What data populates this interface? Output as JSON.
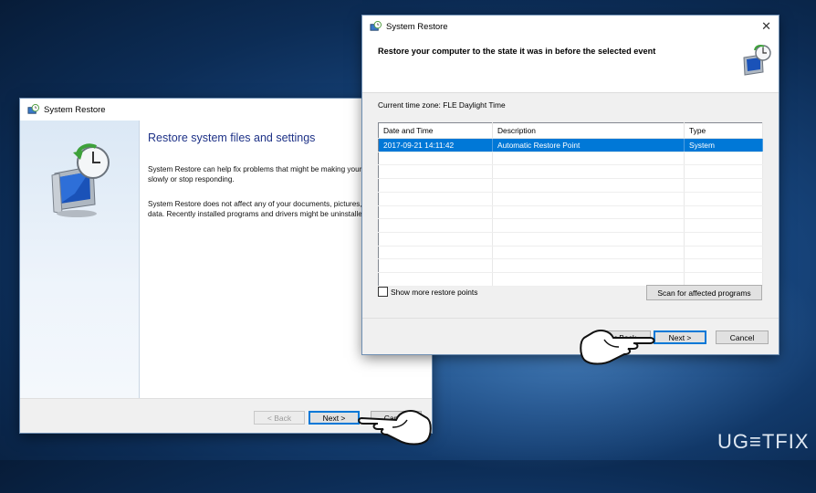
{
  "restore_wizard": {
    "title": "System Restore",
    "heading": "Restore system files and settings",
    "para1": "System Restore can help fix problems that might be making your computer run slowly or stop responding.",
    "para2": "System Restore does not affect any of your documents, pictures, or other personal data. Recently installed programs and drivers might be uninstalled.",
    "back_label": "< Back",
    "next_label": "Next >",
    "cancel_label": "Cancel"
  },
  "restore_points": {
    "title": "System Restore",
    "heading": "Restore your computer to the state it was in before the selected event",
    "timezone": "Current time zone: FLE Daylight Time",
    "columns": [
      "Date and Time",
      "Description",
      "Type"
    ],
    "rows": [
      {
        "date": "2017-09-21 14:11:42",
        "description": "Automatic Restore Point",
        "type": "System",
        "selected": true
      }
    ],
    "show_more_label": "Show more restore points",
    "scan_label": "Scan for affected programs",
    "back_label": "< Back",
    "next_label": "Next >",
    "cancel_label": "Cancel"
  },
  "watermark": "UG≡TFIX",
  "colors": {
    "selection": "#0078d7",
    "heading": "#1e3287",
    "desktop": "#17457d"
  }
}
